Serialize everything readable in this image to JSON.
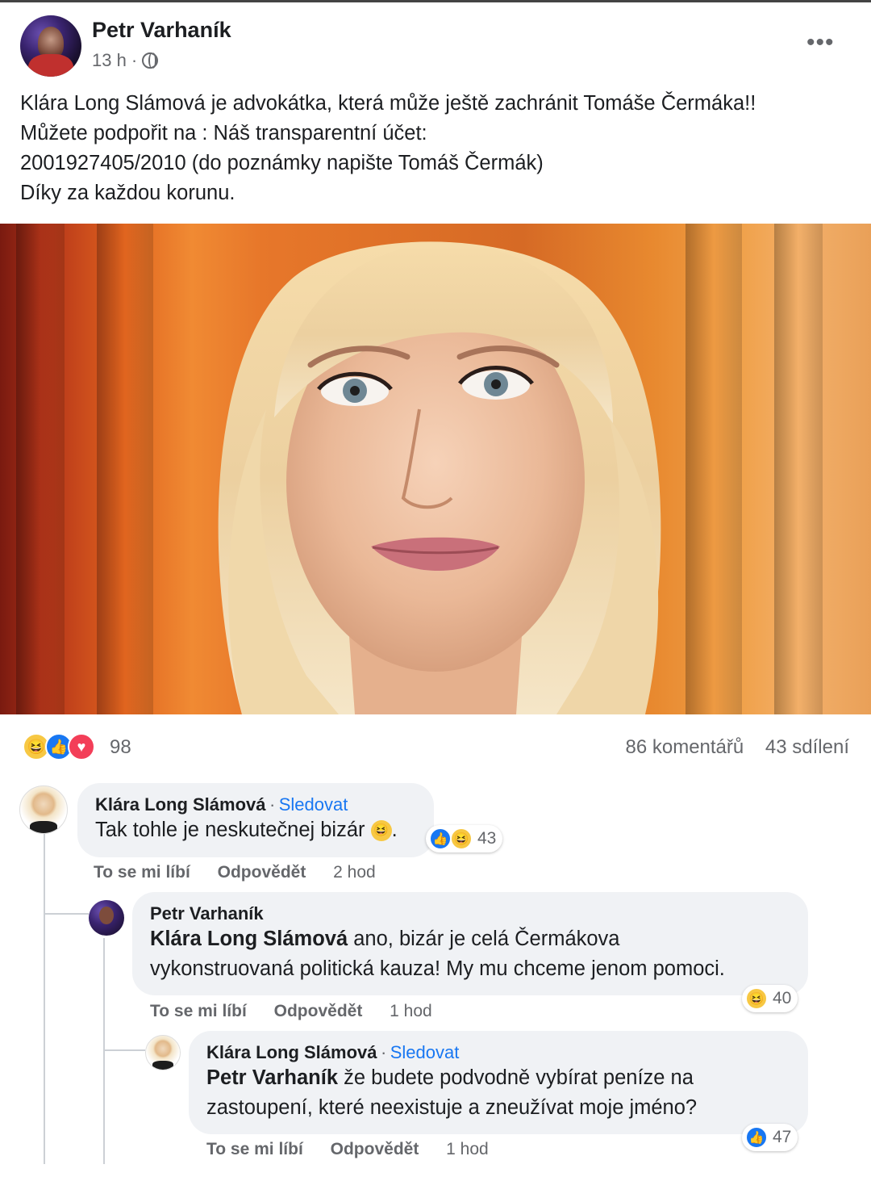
{
  "post": {
    "author": "Petr Varhaník",
    "time": "13 h ·",
    "more_label": "•••",
    "text_lines": [
      "Klára Long Slámová je advokátka, která může ještě zachránit Tomáše Čermáka!!",
      "Můžete podpořit na : Náš transparentní účet:",
      "2001927405/2010  (do poznámky napište Tomáš Čermák)",
      "Díky za každou korunu."
    ]
  },
  "reactions": {
    "icons": [
      "haha-icon",
      "like-icon",
      "love-icon"
    ],
    "count": "98",
    "comments": "86 komentářů",
    "shares": "43 sdílení"
  },
  "comments": [
    {
      "author": "Klára Long Slámová",
      "follow": "Sledovat",
      "text": "Tak tohle je neskutečnej bizár",
      "reaction_count": "43",
      "actions": {
        "like": "To se mi líbí",
        "reply": "Odpovědět",
        "time": "2 hod"
      }
    },
    {
      "author": "Petr Varhaník",
      "mention": "Klára Long Slámová",
      "text_line1": " ano, bizár je celá Čermákova",
      "text_line2": "vykonstruovaná politická kauza! My mu chceme jenom pomoci.",
      "reaction_count": "40",
      "actions": {
        "like": "To se mi líbí",
        "reply": "Odpovědět",
        "time": "1 hod"
      }
    },
    {
      "author": "Klára Long Slámová",
      "follow": "Sledovat",
      "mention": "Petr Varhaník",
      "text_line1": " že budete podvodně vybírat peníze na",
      "text_line2": "zastoupení, které neexistuje a zneužívat moje jméno?",
      "reaction_count": "47",
      "actions": {
        "like": "To se mi líbí",
        "reply": "Odpovědět",
        "time": "1 hod"
      }
    }
  ]
}
